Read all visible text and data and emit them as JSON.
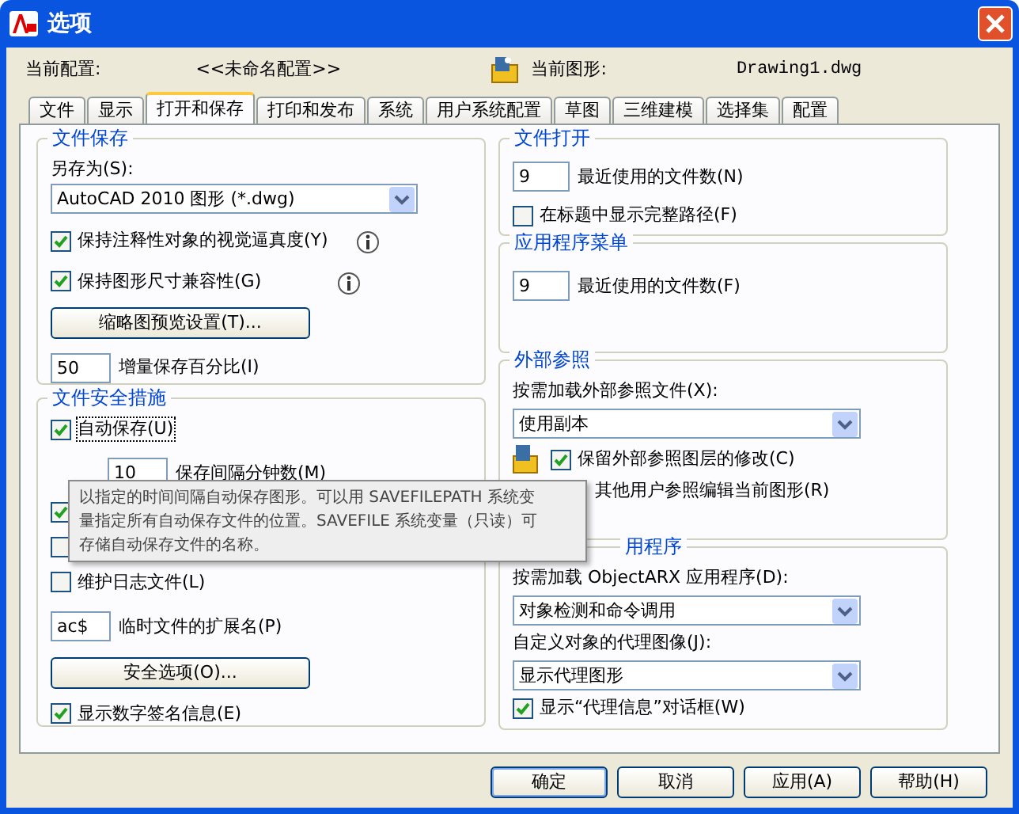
{
  "window": {
    "title": "选项"
  },
  "profile": {
    "label": "当前配置:",
    "value": "<<未命名配置>>"
  },
  "drawing": {
    "label": "当前图形:",
    "value": "Drawing1.dwg"
  },
  "tabs": [
    {
      "label": "文件",
      "selected": false
    },
    {
      "label": "显示",
      "selected": false
    },
    {
      "label": "打开和保存",
      "selected": true
    },
    {
      "label": "打印和发布",
      "selected": false
    },
    {
      "label": "系统",
      "selected": false
    },
    {
      "label": "用户系统配置",
      "selected": false
    },
    {
      "label": "草图",
      "selected": false
    },
    {
      "label": "三维建模",
      "selected": false
    },
    {
      "label": "选择集",
      "selected": false
    },
    {
      "label": "配置",
      "selected": false
    }
  ],
  "left_groups": [
    {
      "title": "文件保存",
      "items": [
        {
          "kind": "label",
          "label": "另存为(S):"
        },
        {
          "kind": "select",
          "value": "AutoCAD 2010 图形 (*.dwg)"
        },
        {
          "kind": "checkbox",
          "label": "保持注释性对象的视觉逼真度(Y)",
          "checked": true,
          "info": true
        },
        {
          "kind": "checkbox",
          "label": "保持图形尺寸兼容性(G)",
          "checked": true,
          "info": true
        },
        {
          "kind": "button",
          "label": "缩略图预览设置(T)..."
        },
        {
          "kind": "number",
          "value": "50",
          "label": "增量保存百分比(I)"
        }
      ]
    },
    {
      "title": "文件安全措施",
      "items": [
        {
          "kind": "checkbox",
          "label": "自动保存(U)",
          "checked": true,
          "focused": true
        },
        {
          "kind": "number",
          "value": "10",
          "label": "保存间隔分钟数(M)",
          "indent": true
        },
        {
          "kind": "checkbox",
          "checked": true
        },
        {
          "kind": "checkbox",
          "checked": false
        },
        {
          "kind": "checkbox",
          "label": "维护日志文件(L)",
          "checked": false
        },
        {
          "kind": "number",
          "value": "ac$",
          "label": "临时文件的扩展名(P)"
        },
        {
          "kind": "button",
          "label": "安全选项(O)..."
        },
        {
          "kind": "checkbox",
          "label": "显示数字签名信息(E)",
          "checked": true
        }
      ]
    }
  ],
  "right_groups": [
    {
      "title": "文件打开",
      "items": [
        {
          "kind": "number",
          "value": "9",
          "label": "最近使用的文件数(N)"
        },
        {
          "kind": "checkbox",
          "label": "在标题中显示完整路径(F)",
          "checked": false
        }
      ]
    },
    {
      "title": "应用程序菜单",
      "items": [
        {
          "kind": "number",
          "value": "9",
          "label": "最近使用的文件数(F)"
        }
      ]
    },
    {
      "title": "外部参照",
      "items": [
        {
          "kind": "label",
          "label": "按需加载外部参照文件(X):"
        },
        {
          "kind": "select",
          "value": "使用副本"
        },
        {
          "kind": "checkbox",
          "label": "保留外部参照图层的修改(C)",
          "checked": true,
          "icon": true
        },
        {
          "kind": "partial",
          "label": "其他用户参照编辑当前图形(R)"
        }
      ]
    },
    {
      "title": "用程序",
      "cut": true,
      "items": [
        {
          "kind": "label",
          "label": "按需加载 ObjectARX 应用程序(D):"
        },
        {
          "kind": "select",
          "value": "对象检测和命令调用"
        },
        {
          "kind": "label",
          "label": "自定义对象的代理图像(J):"
        },
        {
          "kind": "select",
          "value": "显示代理图形"
        },
        {
          "kind": "checkbox",
          "label": "显示“代理信息”对话框(W)",
          "checked": true
        }
      ]
    }
  ],
  "tooltip": {
    "lines": [
      "以指定的时间间隔自动保存图形。可以用 SAVEFILEPATH 系统变",
      "量指定所有自动保存文件的位置。SAVEFILE 系统变量（只读）可",
      "存储自动保存文件的名称。"
    ]
  },
  "buttons": [
    {
      "label": "确定",
      "default": true
    },
    {
      "label": "取消",
      "default": false
    },
    {
      "label": "应用(A)",
      "default": false
    },
    {
      "label": "帮助(H)",
      "default": false
    }
  ]
}
